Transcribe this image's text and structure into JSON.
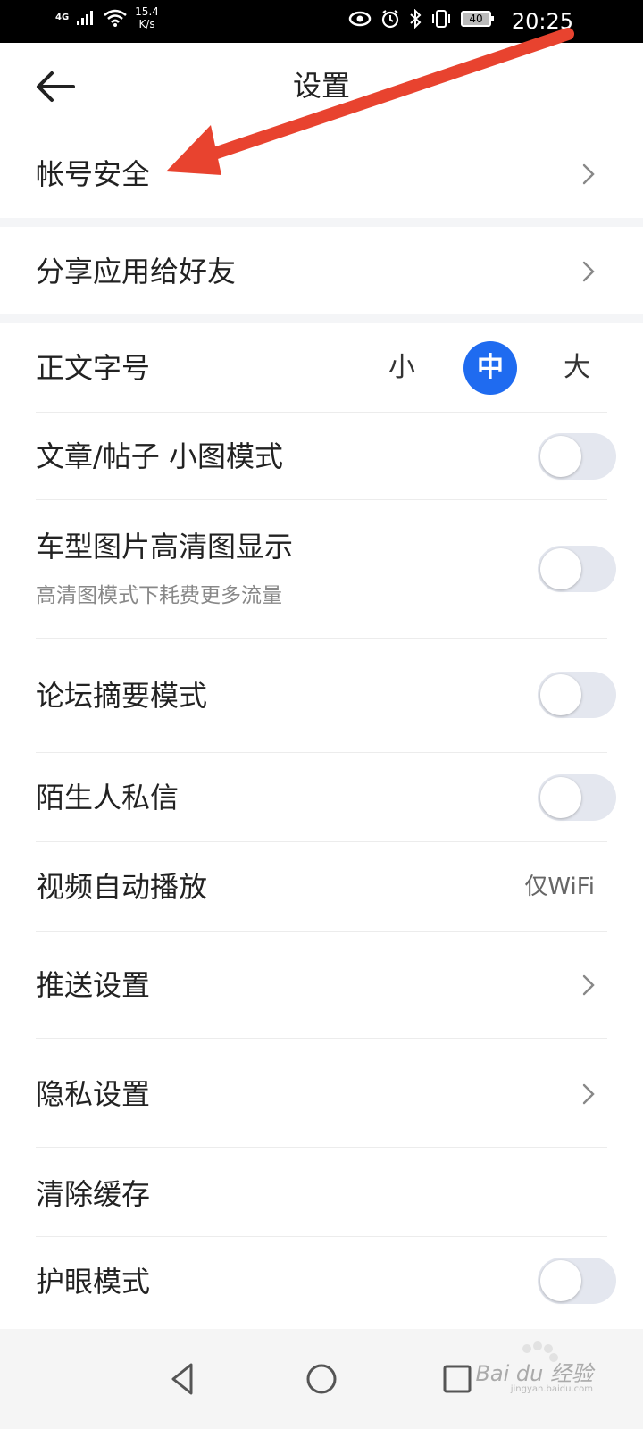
{
  "status_bar": {
    "network": "4G",
    "speed_value": "15.4",
    "speed_unit": "K/s",
    "battery": "40",
    "time": "20:25"
  },
  "header": {
    "title": "设置",
    "back_icon": "arrow-left-icon"
  },
  "rows": {
    "account_security": "帐号安全",
    "share_app": "分享应用给好友",
    "font_size": {
      "label": "正文字号",
      "options": [
        "小",
        "中",
        "大"
      ],
      "selected": "中"
    },
    "small_image_mode": "文章/帖子 小图模式",
    "hd_images": {
      "label": "车型图片高清图显示",
      "subtitle": "高清图模式下耗费更多流量"
    },
    "forum_summary": "论坛摘要模式",
    "stranger_dm": "陌生人私信",
    "video_autoplay": {
      "label": "视频自动播放",
      "value": "仅WiFi"
    },
    "push_settings": "推送设置",
    "privacy_settings": "隐私设置",
    "clear_cache": "清除缓存",
    "eye_care": "护眼模式"
  },
  "toggles": {
    "small_image_mode": false,
    "hd_images": false,
    "forum_summary": false,
    "stranger_dm": false,
    "eye_care": false
  },
  "colors": {
    "accent": "#1f6bf0",
    "annotation_arrow": "#e8432f",
    "toggle_off_track": "#e4e7ef"
  },
  "watermark": {
    "brand": "Bai du 经验",
    "url": "jingyan.baidu.com"
  }
}
